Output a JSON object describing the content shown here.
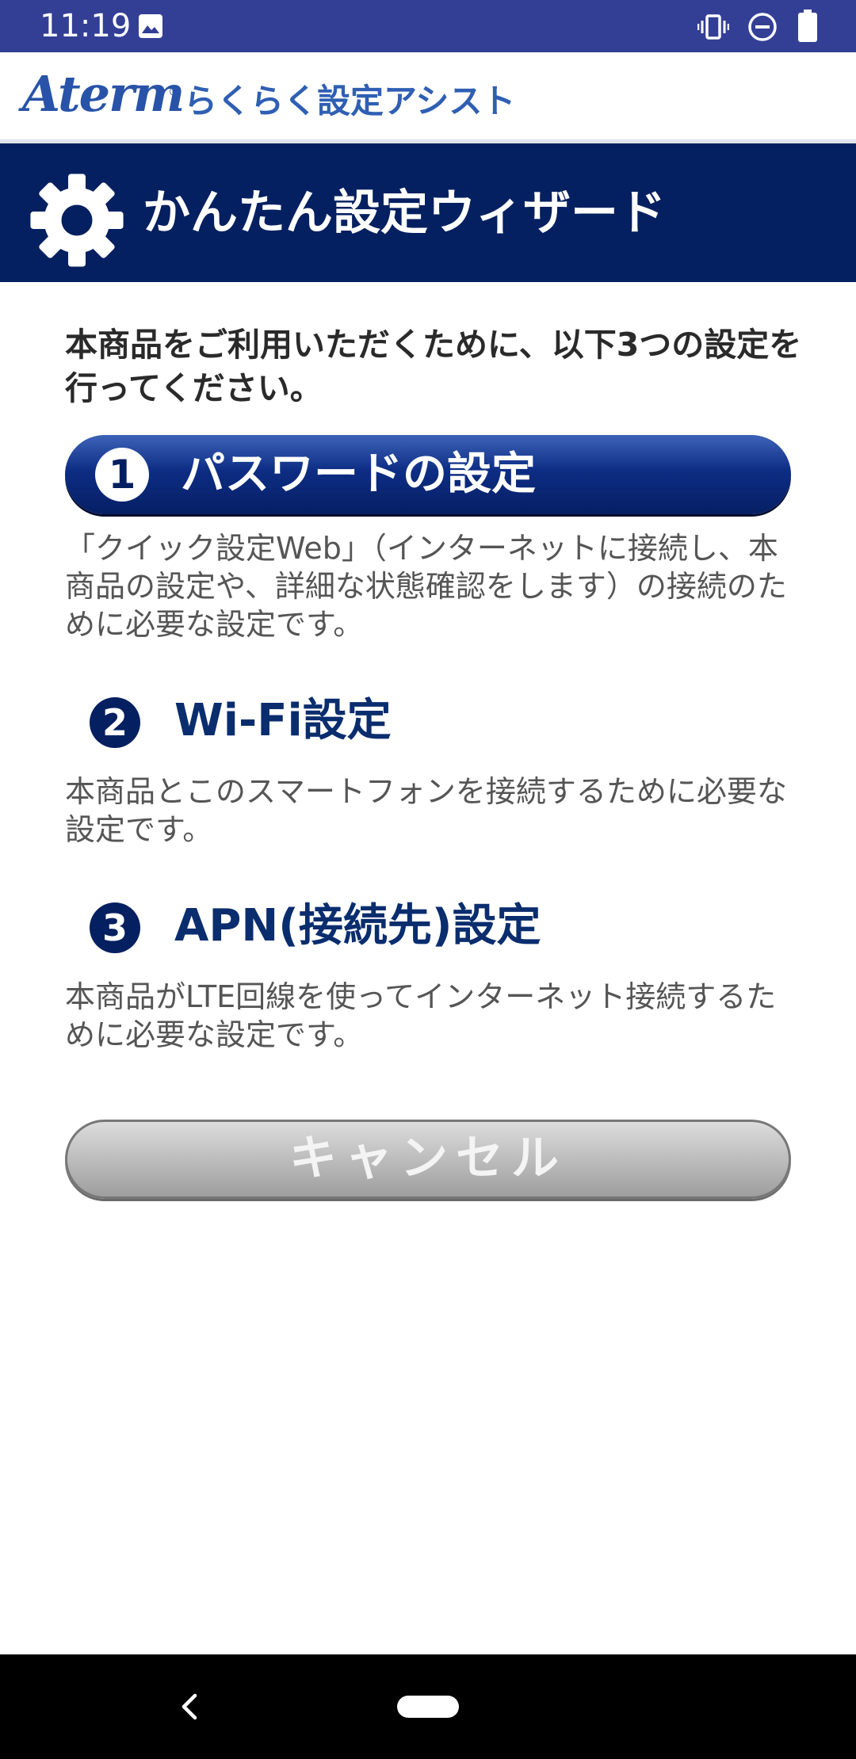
{
  "status_bar": {
    "time": "11:19",
    "icons": [
      "image-icon",
      "vibrate-icon",
      "do-not-disturb-icon",
      "battery-icon"
    ]
  },
  "app_header": {
    "logo_text": "Aterm",
    "logo_mark": "®",
    "subtitle": "らくらく設定アシスト"
  },
  "wizard": {
    "icon": "gear-icon",
    "title": "かんたん設定ウィザード"
  },
  "intro_text": "本商品をご利用いただくために、以下3つの設定を行ってください。",
  "steps": [
    {
      "number": "1",
      "title": "パスワードの設定",
      "description": "「クイック設定Web」（インターネットに接続し、本商品の設定や、詳細な状態確認をします）の接続のために必要な設定です。"
    },
    {
      "number": "2",
      "title": "Wi-Fi設定",
      "description": "本商品とこのスマートフォンを接続するために必要な設定です。"
    },
    {
      "number": "3",
      "title": "APN(接続先)設定",
      "description": "本商品がLTE回線を使ってインターネット接続するために必要な設定です。"
    }
  ],
  "cancel_label": "キャンセル",
  "nav_bar": {
    "icons": [
      "back-icon",
      "home-pill"
    ]
  },
  "colors": {
    "status_bar": "#333f95",
    "banner": "#052060",
    "accent": "#0a2d6e",
    "cancel_button": "#bdbdbd"
  }
}
